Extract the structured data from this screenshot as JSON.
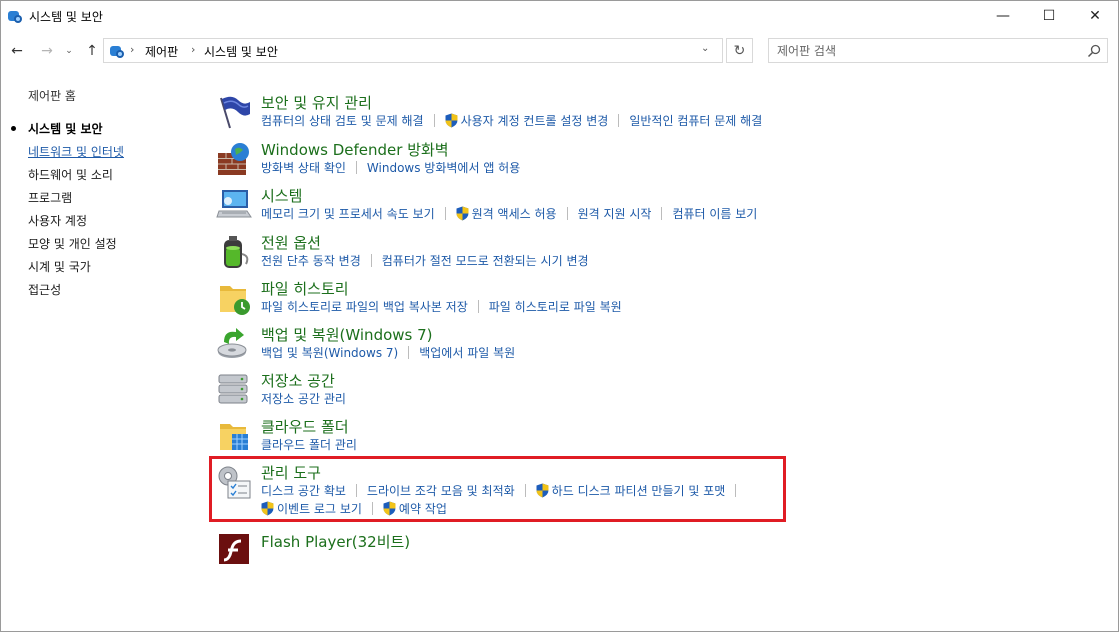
{
  "window": {
    "title": "시스템 및 보안",
    "controls": {
      "minimize": "—",
      "maximize": "☐",
      "close": "✕"
    }
  },
  "nav": {
    "back_glyph": "←",
    "forward_glyph": "→",
    "recent_glyph": "⌄",
    "up_glyph": "↑"
  },
  "address": {
    "separator": "›",
    "parts": [
      "제어판",
      "시스템 및 보안"
    ],
    "dropdown_glyph": "⌄",
    "refresh_glyph": "↻"
  },
  "search": {
    "placeholder": "제어판 검색"
  },
  "left_nav": {
    "home": "제어판 홈",
    "items": [
      {
        "label": "시스템 및 보안",
        "state": "current"
      },
      {
        "label": "네트워크 및 인터넷",
        "state": "hover"
      },
      {
        "label": "하드웨어 및 소리",
        "state": "normal"
      },
      {
        "label": "프로그램",
        "state": "normal"
      },
      {
        "label": "사용자 계정",
        "state": "normal"
      },
      {
        "label": "모양 및 개인 설정",
        "state": "normal"
      },
      {
        "label": "시계 및 국가",
        "state": "normal"
      },
      {
        "label": "접근성",
        "state": "normal"
      }
    ]
  },
  "categories": [
    {
      "title": "보안 및 유지 관리",
      "icon": "flag-icon",
      "rows": [
        [
          {
            "text": "컴퓨터의 상태 검토 및 문제 해결",
            "shield": false
          },
          {
            "text": "사용자 계정 컨트롤 설정 변경",
            "shield": true
          },
          {
            "text": "일반적인 컴퓨터 문제 해결",
            "shield": false
          }
        ]
      ]
    },
    {
      "title": "Windows Defender 방화벽",
      "icon": "firewall-icon",
      "rows": [
        [
          {
            "text": "방화벽 상태 확인",
            "shield": false
          },
          {
            "text": "Windows 방화벽에서 앱 허용",
            "shield": false
          }
        ]
      ]
    },
    {
      "title": "시스템",
      "icon": "computer-icon",
      "rows": [
        [
          {
            "text": "메모리 크기 및 프로세서 속도 보기",
            "shield": false
          },
          {
            "text": "원격 액세스 허용",
            "shield": true
          },
          {
            "text": "원격 지원 시작",
            "shield": false
          },
          {
            "text": "컴퓨터 이름 보기",
            "shield": false
          }
        ]
      ]
    },
    {
      "title": "전원 옵션",
      "icon": "battery-icon",
      "rows": [
        [
          {
            "text": "전원 단추 동작 변경",
            "shield": false
          },
          {
            "text": "컴퓨터가 절전 모드로 전환되는 시기 변경",
            "shield": false
          }
        ]
      ]
    },
    {
      "title": "파일 히스토리",
      "icon": "file-history-icon",
      "rows": [
        [
          {
            "text": "파일 히스토리로 파일의 백업 복사본 저장",
            "shield": false
          },
          {
            "text": "파일 히스토리로 파일 복원",
            "shield": false
          }
        ]
      ]
    },
    {
      "title": "백업 및 복원(Windows 7)",
      "icon": "backup-icon",
      "rows": [
        [
          {
            "text": "백업 및 복원(Windows 7)",
            "shield": false
          },
          {
            "text": "백업에서 파일 복원",
            "shield": false
          }
        ]
      ]
    },
    {
      "title": "저장소 공간",
      "icon": "storage-icon",
      "rows": [
        [
          {
            "text": "저장소 공간 관리",
            "shield": false
          }
        ]
      ]
    },
    {
      "title": "클라우드 폴더",
      "icon": "cloud-folder-icon",
      "rows": [
        [
          {
            "text": "클라우드 폴더 관리",
            "shield": false
          }
        ]
      ]
    },
    {
      "title": "관리 도구",
      "icon": "admin-tools-icon",
      "rows": [
        [
          {
            "text": "디스크 공간 확보",
            "shield": false
          },
          {
            "text": "드라이브 조각 모음 및 최적화",
            "shield": false
          },
          {
            "text": "하드 디스크 파티션 만들기 및 포맷",
            "shield": true
          }
        ],
        [
          {
            "text": "이벤트 로그 보기",
            "shield": true
          },
          {
            "text": "예약 작업",
            "shield": true
          }
        ]
      ]
    },
    {
      "title": "Flash Player(32비트)",
      "icon": "flash-icon",
      "rows": []
    }
  ],
  "colors": {
    "category_title": "#1c6f1c",
    "link": "#1e5aa8",
    "highlight_border": "#e01c24"
  }
}
